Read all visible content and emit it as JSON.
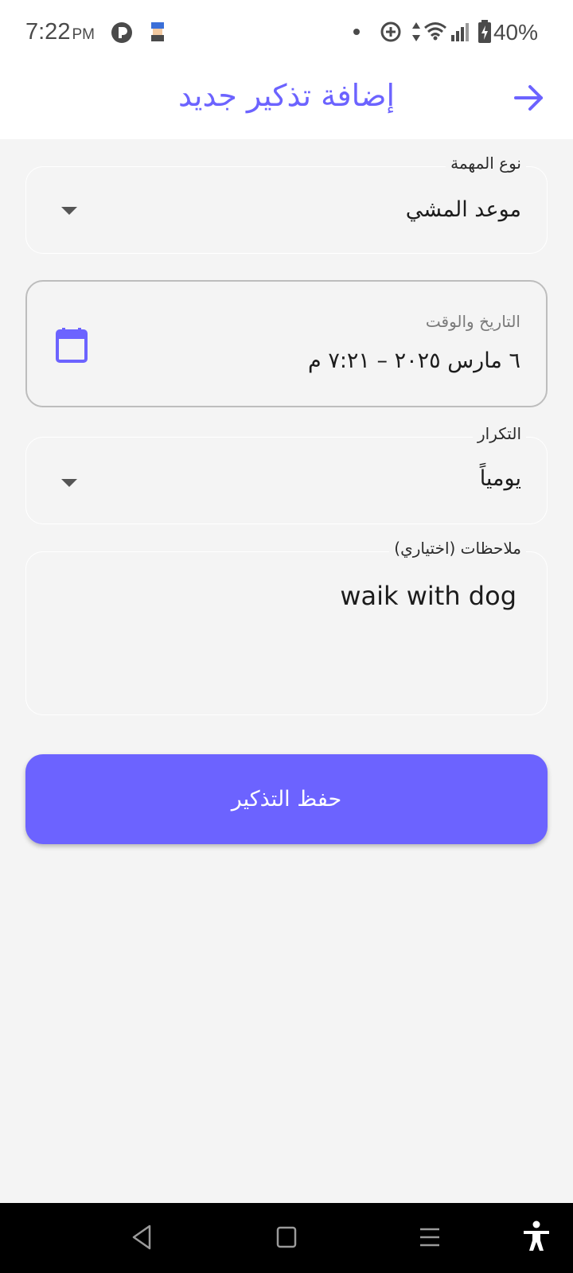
{
  "status_bar": {
    "time": "7:22",
    "ampm": "PM",
    "battery": "40%"
  },
  "app_bar": {
    "title": "إضافة تذكير جديد",
    "accent_color": "#6c63ff",
    "back_icon": "arrow-right-icon"
  },
  "form": {
    "task_type": {
      "label": "نوع المهمة",
      "value": "موعد المشي"
    },
    "datetime": {
      "label": "التاريخ والوقت",
      "value": "٦ مارس ٢٠٢٥ – ٧:٢١ م",
      "icon": "calendar-icon"
    },
    "repeat": {
      "label": "التكرار",
      "value": "يومياً"
    },
    "notes": {
      "label": "ملاحظات (اختياري)",
      "value": "waik with dog"
    }
  },
  "save_button": {
    "label": "حفظ التذكير"
  },
  "nav_bar": {
    "icons": [
      "back-nav-icon",
      "home-nav-icon",
      "recents-nav-icon",
      "accessibility-icon"
    ]
  }
}
